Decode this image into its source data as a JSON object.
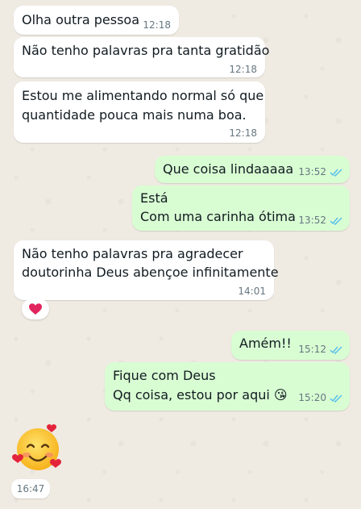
{
  "messages": [
    {
      "dir": "in",
      "lines": [
        "Olha outra pessoa"
      ],
      "time": "12:18"
    },
    {
      "dir": "in",
      "lines": [
        "Não tenho palavras pra tanta gratidão"
      ],
      "time": "12:18"
    },
    {
      "dir": "in",
      "lines": [
        "Estou me alimentando normal só que",
        "quantidade pouca mais numa boa."
      ],
      "time": "12:18"
    },
    {
      "dir": "out",
      "lines": [
        "Que coisa lindaaaaa"
      ],
      "time": "13:52",
      "status": "read"
    },
    {
      "dir": "out",
      "lines": [
        "Está",
        "Com uma carinha ótima"
      ],
      "time": "13:52",
      "status": "read"
    },
    {
      "dir": "in",
      "lines": [
        "Não tenho palavras pra agradecer",
        "doutorinha Deus abençoe infinitamente"
      ],
      "time": "14:01",
      "reaction": "heart"
    },
    {
      "dir": "out",
      "lines": [
        "Amém!!"
      ],
      "time": "15:12",
      "status": "read"
    },
    {
      "dir": "out",
      "lines": [
        "Fique com Deus",
        "Qq coisa, estou por aqui 😘"
      ],
      "time": "15:20",
      "status": "read"
    },
    {
      "dir": "in",
      "emoji": "smiling-face-with-hearts",
      "time": "16:47"
    }
  ],
  "colors": {
    "incoming": "#ffffff",
    "outgoing": "#d9fdd3",
    "read_ticks": "#53bdeb",
    "wallpaper": "#efeae2"
  }
}
